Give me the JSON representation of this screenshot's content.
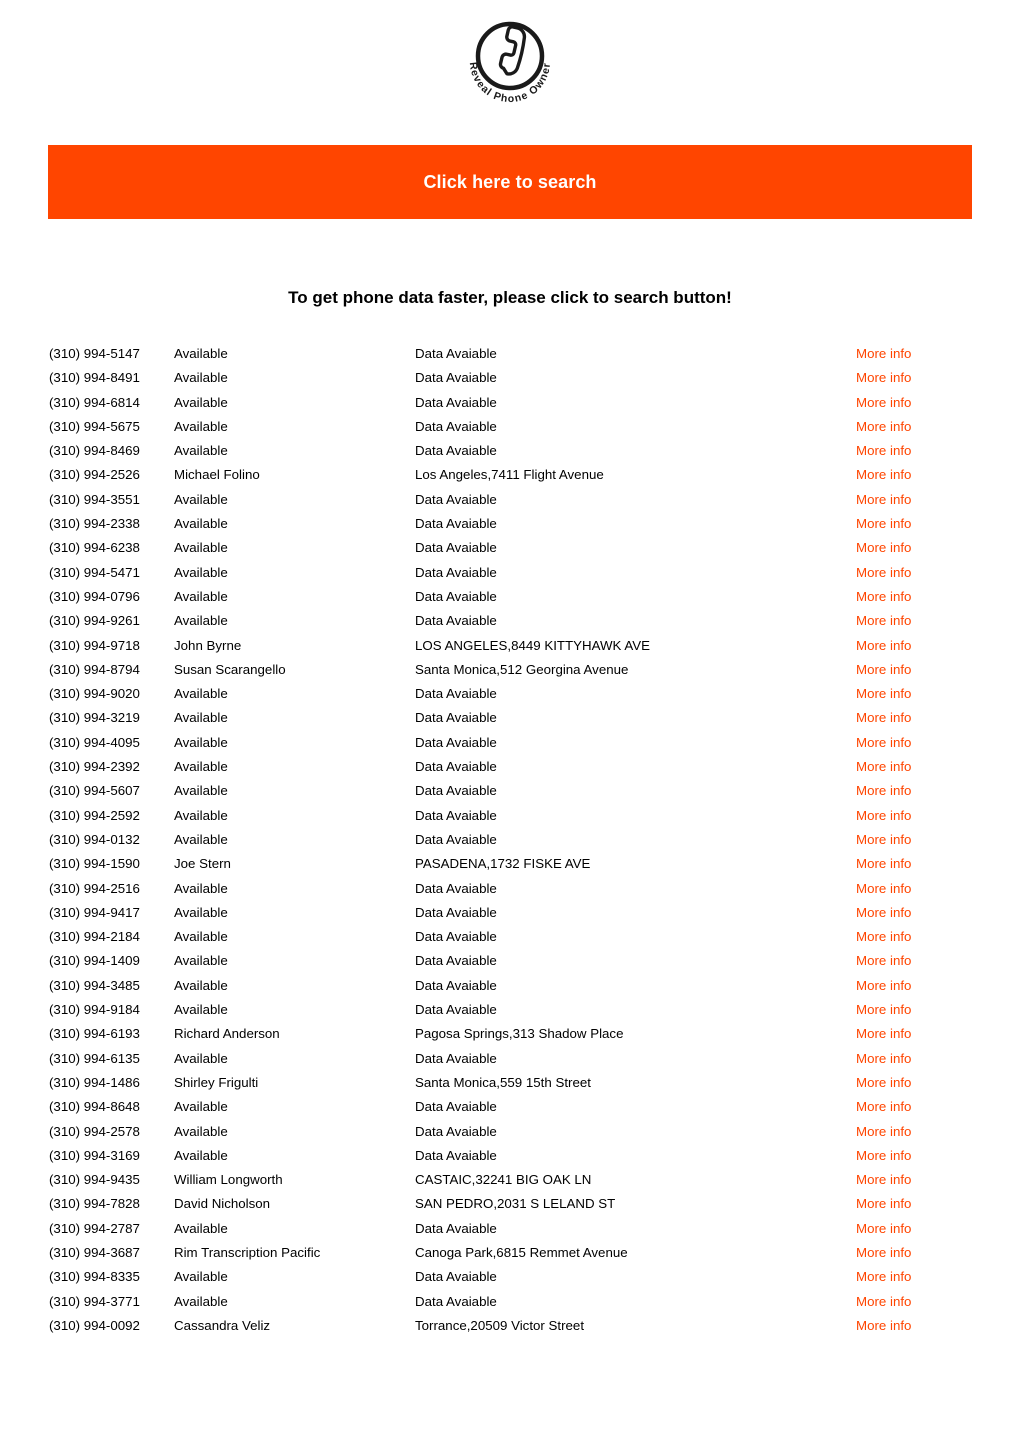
{
  "logo": {
    "icon": "phone-handset-icon",
    "brand_text": "Reveal Phone Owner",
    "brand_words": [
      "Reveal",
      "Phone",
      "Owner"
    ]
  },
  "banner": {
    "label": "Click here to search",
    "background_color": "#ff4500",
    "text_color": "#ffffff"
  },
  "headline": {
    "text": "To get phone data faster, please click to search button!"
  },
  "listing": {
    "link_label": "More info",
    "link_color": "#ff4500",
    "placeholder_name": "Available",
    "placeholder_address": "Data Avaiable",
    "rows": [
      {
        "phone": "(310) 994-5147",
        "name": "Available",
        "address": "Data Avaiable",
        "link": "More info"
      },
      {
        "phone": "(310) 994-8491",
        "name": "Available",
        "address": "Data Avaiable",
        "link": "More info"
      },
      {
        "phone": "(310) 994-6814",
        "name": "Available",
        "address": "Data Avaiable",
        "link": "More info"
      },
      {
        "phone": "(310) 994-5675",
        "name": "Available",
        "address": "Data Avaiable",
        "link": "More info"
      },
      {
        "phone": "(310) 994-8469",
        "name": "Available",
        "address": "Data Avaiable",
        "link": "More info"
      },
      {
        "phone": "(310) 994-2526",
        "name": "Michael Folino",
        "address": "Los Angeles,7411 Flight Avenue",
        "link": "More info"
      },
      {
        "phone": "(310) 994-3551",
        "name": "Available",
        "address": "Data Avaiable",
        "link": "More info"
      },
      {
        "phone": "(310) 994-2338",
        "name": "Available",
        "address": "Data Avaiable",
        "link": "More info"
      },
      {
        "phone": "(310) 994-6238",
        "name": "Available",
        "address": "Data Avaiable",
        "link": "More info"
      },
      {
        "phone": "(310) 994-5471",
        "name": "Available",
        "address": "Data Avaiable",
        "link": "More info"
      },
      {
        "phone": "(310) 994-0796",
        "name": "Available",
        "address": "Data Avaiable",
        "link": "More info"
      },
      {
        "phone": "(310) 994-9261",
        "name": "Available",
        "address": "Data Avaiable",
        "link": "More info"
      },
      {
        "phone": "(310) 994-9718",
        "name": "John Byrne",
        "address": "LOS ANGELES,8449 KITTYHAWK AVE",
        "link": "More info"
      },
      {
        "phone": "(310) 994-8794",
        "name": "Susan Scarangello",
        "address": "Santa Monica,512 Georgina Avenue",
        "link": "More info"
      },
      {
        "phone": "(310) 994-9020",
        "name": "Available",
        "address": "Data Avaiable",
        "link": "More info"
      },
      {
        "phone": "(310) 994-3219",
        "name": "Available",
        "address": "Data Avaiable",
        "link": "More info"
      },
      {
        "phone": "(310) 994-4095",
        "name": "Available",
        "address": "Data Avaiable",
        "link": "More info"
      },
      {
        "phone": "(310) 994-2392",
        "name": "Available",
        "address": "Data Avaiable",
        "link": "More info"
      },
      {
        "phone": "(310) 994-5607",
        "name": "Available",
        "address": "Data Avaiable",
        "link": "More info"
      },
      {
        "phone": "(310) 994-2592",
        "name": "Available",
        "address": "Data Avaiable",
        "link": "More info"
      },
      {
        "phone": "(310) 994-0132",
        "name": "Available",
        "address": "Data Avaiable",
        "link": "More info"
      },
      {
        "phone": "(310) 994-1590",
        "name": "Joe Stern",
        "address": "PASADENA,1732 FISKE AVE",
        "link": "More info"
      },
      {
        "phone": "(310) 994-2516",
        "name": "Available",
        "address": "Data Avaiable",
        "link": "More info"
      },
      {
        "phone": "(310) 994-9417",
        "name": "Available",
        "address": "Data Avaiable",
        "link": "More info"
      },
      {
        "phone": "(310) 994-2184",
        "name": "Available",
        "address": "Data Avaiable",
        "link": "More info"
      },
      {
        "phone": "(310) 994-1409",
        "name": "Available",
        "address": "Data Avaiable",
        "link": "More info"
      },
      {
        "phone": "(310) 994-3485",
        "name": "Available",
        "address": "Data Avaiable",
        "link": "More info"
      },
      {
        "phone": "(310) 994-9184",
        "name": "Available",
        "address": "Data Avaiable",
        "link": "More info"
      },
      {
        "phone": "(310) 994-6193",
        "name": "Richard Anderson",
        "address": "Pagosa Springs,313 Shadow Place",
        "link": "More info"
      },
      {
        "phone": "(310) 994-6135",
        "name": "Available",
        "address": "Data Avaiable",
        "link": "More info"
      },
      {
        "phone": "(310) 994-1486",
        "name": "Shirley Frigulti",
        "address": "Santa Monica,559 15th Street",
        "link": "More info"
      },
      {
        "phone": "(310) 994-8648",
        "name": "Available",
        "address": "Data Avaiable",
        "link": "More info"
      },
      {
        "phone": "(310) 994-2578",
        "name": "Available",
        "address": "Data Avaiable",
        "link": "More info"
      },
      {
        "phone": "(310) 994-3169",
        "name": "Available",
        "address": "Data Avaiable",
        "link": "More info"
      },
      {
        "phone": "(310) 994-9435",
        "name": "William Longworth",
        "address": "CASTAIC,32241 BIG OAK LN",
        "link": "More info"
      },
      {
        "phone": "(310) 994-7828",
        "name": "David Nicholson",
        "address": "SAN PEDRO,2031 S LELAND ST",
        "link": "More info"
      },
      {
        "phone": "(310) 994-2787",
        "name": "Available",
        "address": "Data Avaiable",
        "link": "More info"
      },
      {
        "phone": "(310) 994-3687",
        "name": "Rim Transcription Pacific",
        "address": "Canoga Park,6815 Remmet Avenue",
        "link": "More info"
      },
      {
        "phone": "(310) 994-8335",
        "name": "Available",
        "address": "Data Avaiable",
        "link": "More info"
      },
      {
        "phone": "(310) 994-3771",
        "name": "Available",
        "address": "Data Avaiable",
        "link": "More info"
      },
      {
        "phone": "(310) 994-0092",
        "name": "Cassandra Veliz",
        "address": "Torrance,20509 Victor Street",
        "link": "More info"
      }
    ]
  }
}
